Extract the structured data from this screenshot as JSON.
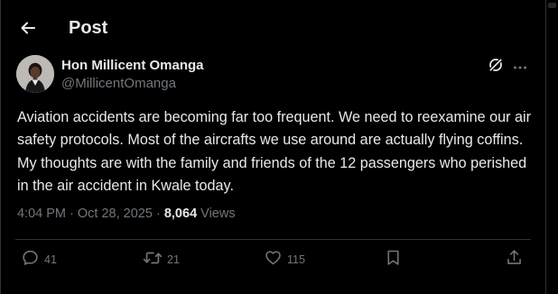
{
  "header": {
    "title": "Post"
  },
  "post": {
    "author_name": "Hon Millicent Omanga",
    "author_handle": "@MillicentOmanga",
    "text": "Aviation accidents are becoming far too frequent. We need to reexamine our air safety protocols. Most of the aircrafts we use around are actually flying coffins. My thoughts are with the family and friends of the 12 passengers who perished in the air accident in Kwale today.",
    "time": "4:04 PM",
    "date": "Oct 28, 2025",
    "separator": "·",
    "views_count": "8,064",
    "views_label": "Views"
  },
  "actions": {
    "replies": "41",
    "reposts": "21",
    "likes": "115"
  },
  "icons": [
    "back-arrow-icon",
    "grok-icon",
    "more-icon",
    "reply-icon",
    "repost-icon",
    "like-icon",
    "bookmark-icon",
    "share-icon"
  ],
  "colors": {
    "background": "#000000",
    "text": "#e7e9ea",
    "secondary": "#71767b",
    "border": "#2f3336"
  }
}
